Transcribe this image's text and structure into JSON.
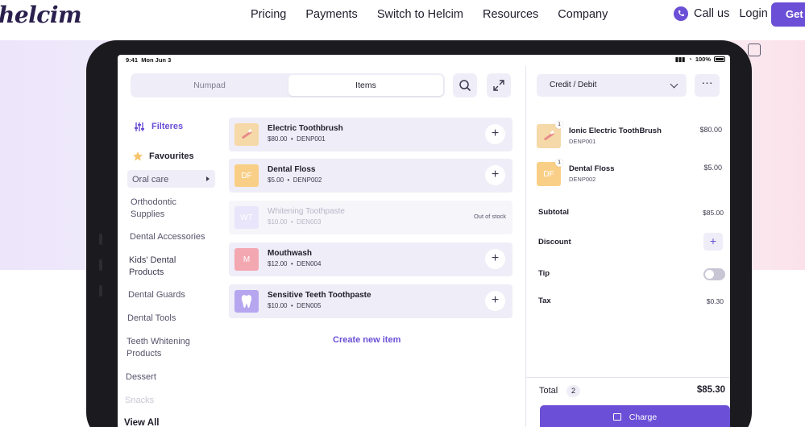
{
  "site": {
    "logo": "helcim",
    "nav": [
      "Pricing",
      "Payments",
      "Switch to Helcim",
      "Resources",
      "Company"
    ],
    "call_us": "Call us",
    "login": "Login",
    "get_started": "Get s",
    "accent": "#6b4fd6"
  },
  "device": {
    "time": "9:41",
    "date": "Mon Jun 3",
    "battery": "100%"
  },
  "tabs": {
    "numpad": "Numpad",
    "items": "Items"
  },
  "categories": {
    "filters": "Filteres",
    "favourites": "Favourites",
    "items": [
      "Oral care",
      "Orthodontic",
      "Supplies",
      "Dental Accessories",
      "Kids' Dental",
      "Products",
      "Dental Guards",
      "Dental Tools",
      "Teeth Whitening",
      "Products",
      "Dessert",
      "Snacks",
      "View All"
    ]
  },
  "products": [
    {
      "name": "Electric Toothbrush",
      "price": "$80.00",
      "sku": "DENP001",
      "thumb": "",
      "color": "#f6d9a8"
    },
    {
      "name": "Dental Floss",
      "price": "$5.00",
      "sku": "DENP002",
      "thumb": "DF",
      "color": "#f9cf87"
    },
    {
      "name": "Whitening Toothpaste",
      "price": "$10.00",
      "sku": "DEN003",
      "thumb": "WT",
      "color": "#dcd6f7",
      "status": "Out of stock"
    },
    {
      "name": "Mouthwash",
      "price": "$12.00",
      "sku": "DEN004",
      "thumb": "M",
      "color": "#f3a7b1"
    },
    {
      "name": "Sensitive Teeth Toothpaste",
      "price": "$10.00",
      "sku": "DEN005",
      "thumb": "",
      "color": "#b6a6ef"
    }
  ],
  "create_item": "Create new item",
  "payment": {
    "method": "Credit / Debit",
    "more": "···"
  },
  "cart": [
    {
      "qty": "1",
      "name": "Ionic Electric ToothBrush",
      "sku": "DENP001",
      "price": "$80.00",
      "thumb": ""
    },
    {
      "qty": "1",
      "name": "Dental Floss",
      "sku": "DENP002",
      "price": "$5.00",
      "thumb": "DF"
    }
  ],
  "summary": {
    "subtotal_label": "Subtotal",
    "subtotal": "$85.00",
    "discount_label": "Discount",
    "tip_label": "Tip",
    "tax_label": "Tax",
    "tax": "$0.30",
    "total_label": "Total",
    "total_count": "2",
    "total": "$85.30",
    "charge": "Charge"
  }
}
